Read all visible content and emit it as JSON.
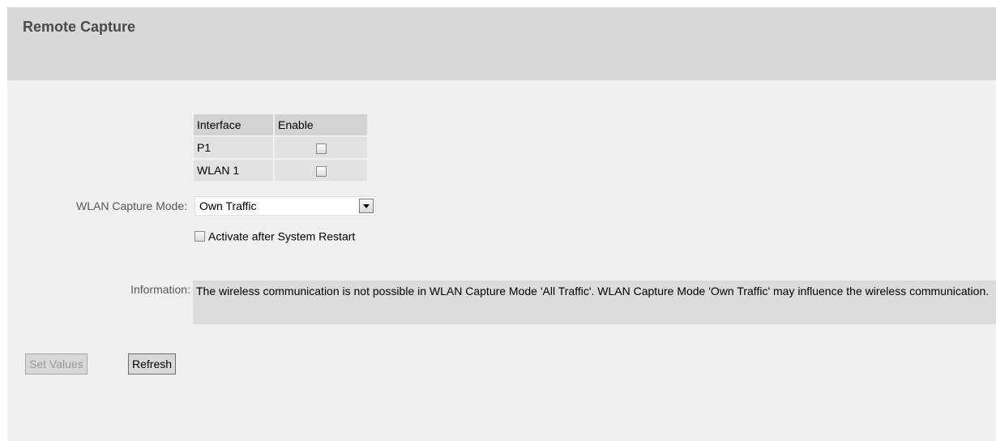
{
  "page": {
    "title": "Remote Capture"
  },
  "interfaces": {
    "headers": {
      "interface": "Interface",
      "enable": "Enable"
    },
    "rows": [
      {
        "name": "P1",
        "enabled": false
      },
      {
        "name": "WLAN 1",
        "enabled": false
      }
    ]
  },
  "capture_mode": {
    "label": "WLAN Capture Mode:",
    "value": "Own Traffic"
  },
  "restart": {
    "label": "Activate after System Restart",
    "checked": false
  },
  "information": {
    "label": "Information:",
    "text": "The wireless communication is not possible in WLAN Capture Mode 'All Traffic'. WLAN Capture Mode 'Own Traffic' may influence the wireless communication."
  },
  "buttons": {
    "set_values": "Set Values",
    "refresh": "Refresh"
  }
}
